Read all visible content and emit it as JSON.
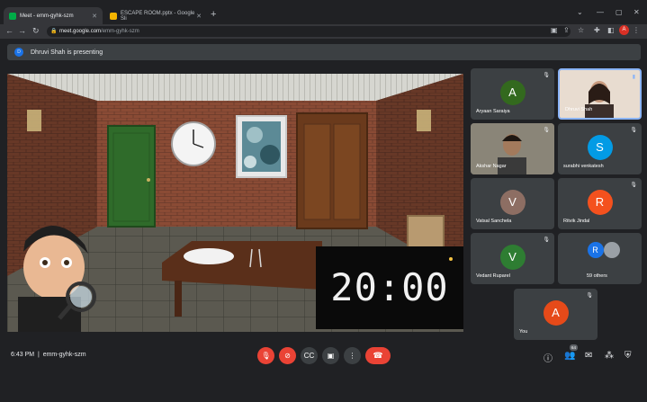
{
  "browser": {
    "tabs": [
      {
        "title": "Meet - emm-gyhk-szm",
        "favicon_color": "#00ac47",
        "active": true
      },
      {
        "title": "ESCAPE ROOM.pptx - Google Sli",
        "favicon_color": "#f4b400",
        "active": false
      }
    ],
    "url_host": "meet.google.com",
    "url_path": "/emm-gyhk-szm",
    "profile_initial": "A"
  },
  "meet": {
    "presenting_initial": "D",
    "presenting_text": "Dhruvi Shah is presenting",
    "timer_display": "20:00",
    "participants": [
      {
        "name": "Aryaan Saraiya",
        "initial": "A",
        "color": "#33691e"
      },
      {
        "name": "Dhruvi Shah",
        "initial": "",
        "color": ""
      },
      {
        "name": "Akshar Nagar",
        "initial": "",
        "color": ""
      },
      {
        "name": "surabhi venkatesh",
        "initial": "S",
        "color": "#039be5"
      },
      {
        "name": "Vatsal Sanchela",
        "initial": "V",
        "color": "#8d6e63"
      },
      {
        "name": "Ritvik Jindal",
        "initial": "R",
        "color": "#f4511e"
      },
      {
        "name": "Vedant Ruparel",
        "initial": "V",
        "color": "#2e7d32"
      },
      {
        "name": "59 others",
        "initial": "R",
        "color": "#1a73e8"
      },
      {
        "name": "You",
        "initial": "A",
        "color": "#e64a19"
      }
    ],
    "meeting_time": "6:43 PM",
    "meeting_code": "emm-gyhk-szm",
    "people_count": "64"
  },
  "colors": {
    "danger": "#ea4335",
    "bar_bg": "#3c4043",
    "page_bg": "#202124"
  }
}
